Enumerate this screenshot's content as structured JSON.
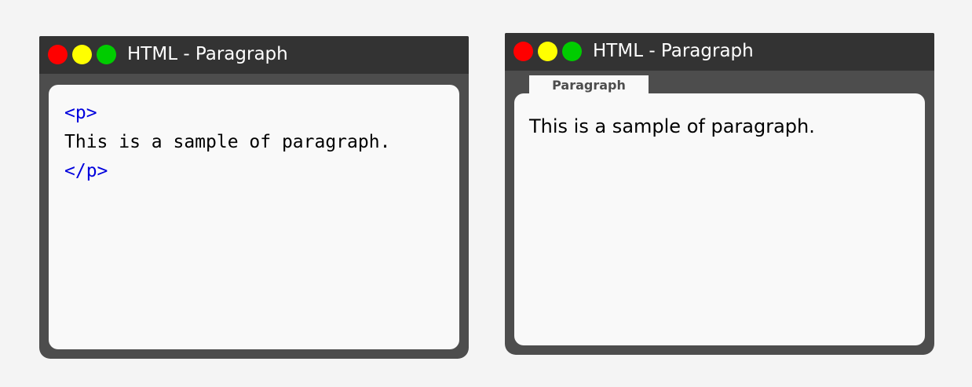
{
  "code_window": {
    "title": "HTML - Paragraph",
    "code_lines": {
      "open_tag": "<p>",
      "text": "This is a sample of paragraph.",
      "close_tag": "</p>"
    }
  },
  "preview_window": {
    "title": "HTML - Paragraph",
    "tab_label": "Paragraph",
    "paragraph": "This is a sample of paragraph."
  },
  "colors": {
    "close": "#ff0000",
    "minimize": "#ffff00",
    "maximize": "#00cc00",
    "tag": "#0000dd",
    "frame": "#4d4d4d",
    "titlebar": "#333333"
  }
}
